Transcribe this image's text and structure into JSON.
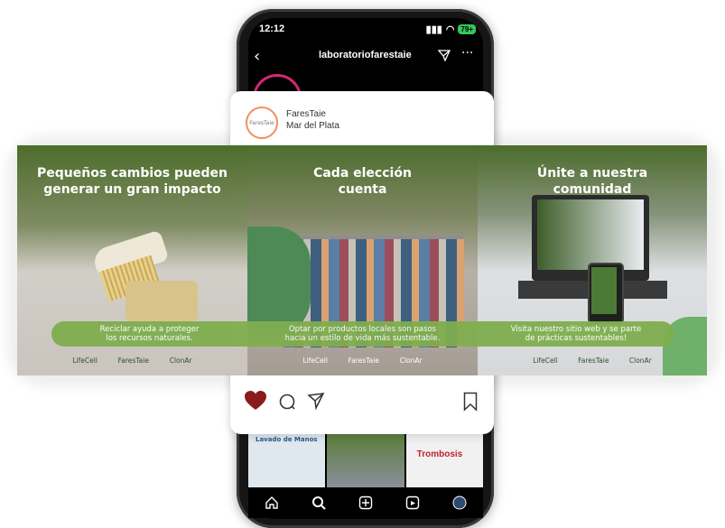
{
  "status_bar": {
    "time": "12:12",
    "battery": "79+"
  },
  "profile": {
    "username": "laboratoriofarestaie"
  },
  "post": {
    "author_name": "FaresTaie",
    "location": "Mar del Plata",
    "avatar_text": "FaresTaie"
  },
  "slides": [
    {
      "title_line1": "Pequeños cambios pueden",
      "title_line2": "generar un gran impacto",
      "caption_line1": "Reciclar ayuda a proteger",
      "caption_line2": "los recursos naturales."
    },
    {
      "title_line1": "Cada elección",
      "title_line2": "cuenta",
      "caption_line1": "Optar por productos locales son pasos",
      "caption_line2": "hacia un estilo de vida más sustentable."
    },
    {
      "title_line1": "Únite a nuestra",
      "title_line2": "comunidad",
      "caption_line1": "Visita nuestro sitio web y se parte",
      "caption_line2": "de prácticas sustentables!"
    }
  ],
  "logos": [
    "LifeCell",
    "FaresTaie",
    "ClonAr"
  ],
  "grid_thumbs": [
    "Lavado de Manos",
    "",
    "Trombosis"
  ],
  "colors": {
    "accent_green": "#7fae4f",
    "heart": "#8b1a1a"
  }
}
